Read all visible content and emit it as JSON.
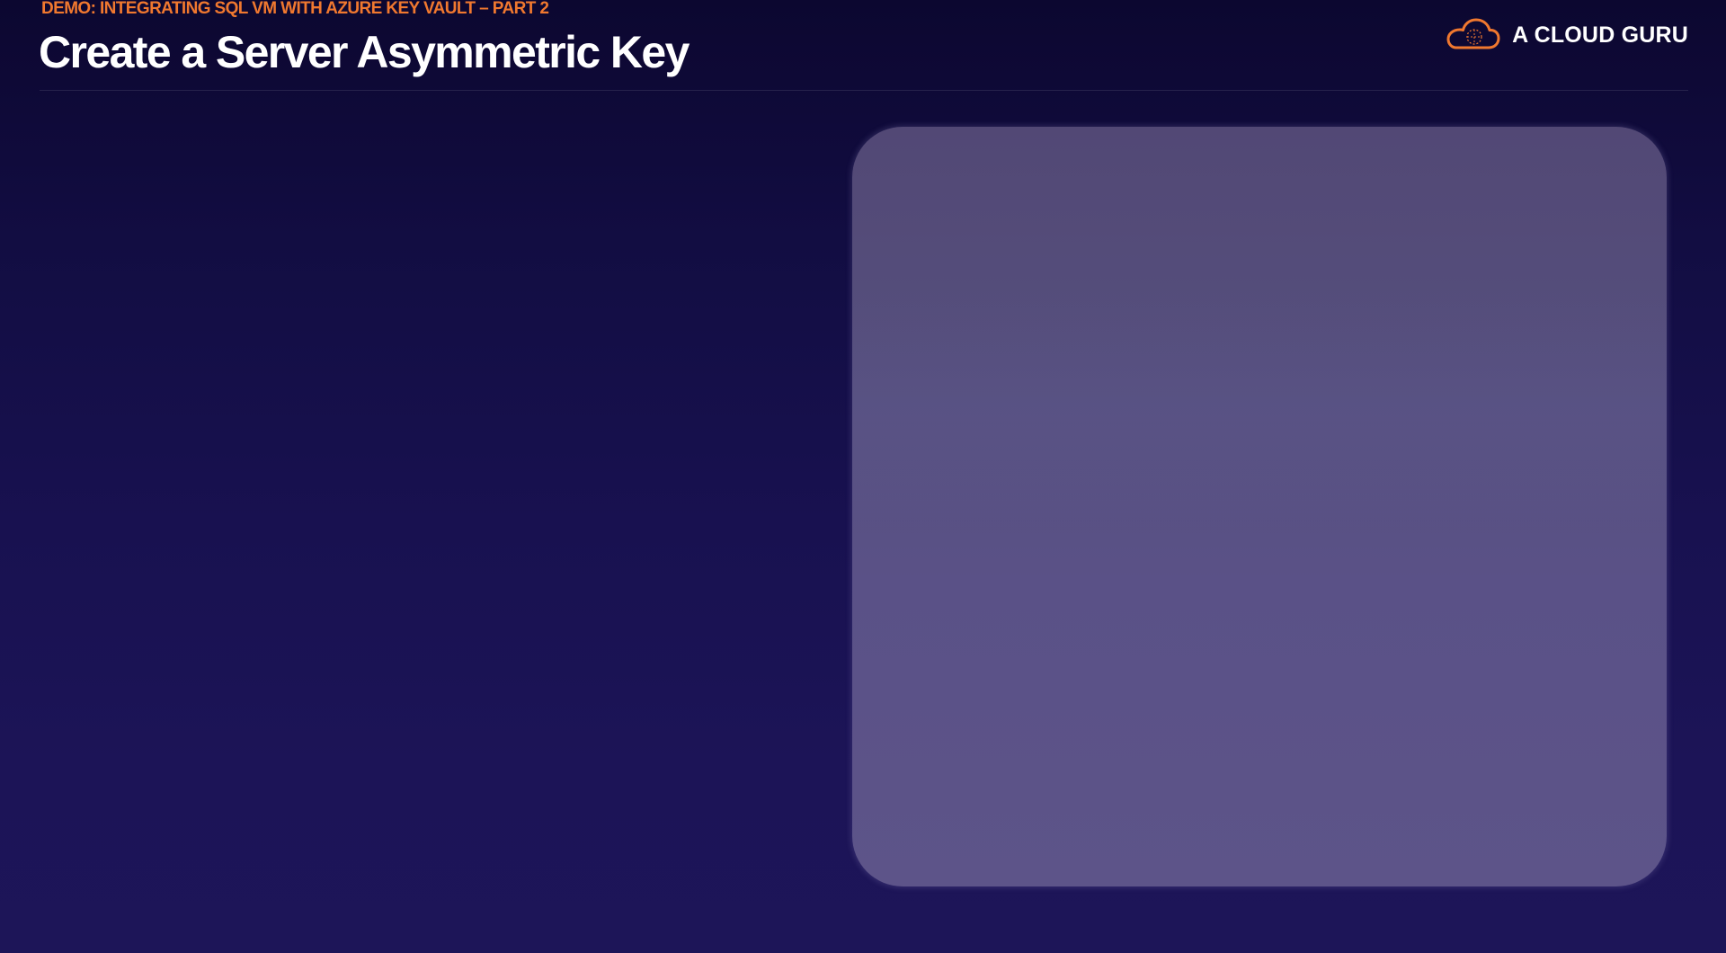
{
  "slide": {
    "eyebrow": "DEMO: INTEGRATING SQL VM WITH AZURE KEY VAULT – PART 2",
    "title": "Create a Server Asymmetric Key"
  },
  "brand": {
    "name": "A CLOUD GURU",
    "logo_icon": "cloud-logo-icon",
    "accent_color": "#f0782f"
  },
  "colors": {
    "background_top": "#0c0730",
    "background_bottom": "#1d1558",
    "panel": "#574e80",
    "title": "#ffffff"
  }
}
